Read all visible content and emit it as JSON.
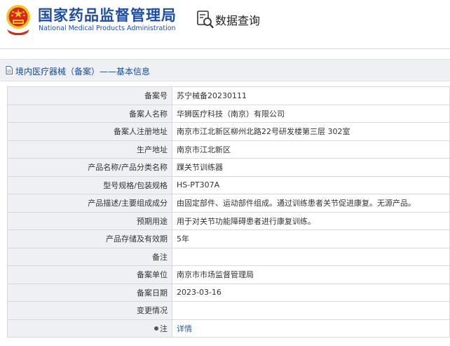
{
  "header": {
    "agency_name_cn": "国家药品监督管理局",
    "agency_name_en": "National Medical Products Administration",
    "page_title": "数据查询"
  },
  "breadcrumb": {
    "text": "境内医疗器械（备案）——基本信息"
  },
  "records": [
    {
      "label": "备案号",
      "value": "苏宁械备20230111"
    },
    {
      "label": "备案人名称",
      "value": "华狮医疗科技（南京）有限公司"
    },
    {
      "label": "备案人注册地址",
      "value": "南京市江北新区柳州北路22号研发楼第三层 302室"
    },
    {
      "label": "生产地址",
      "value": "南京市江北新区"
    },
    {
      "label": "产品名称/产品分类名称",
      "value": "踝关节训练器"
    },
    {
      "label": "型号规格/包装规格",
      "value": "HS-PT307A"
    },
    {
      "label": "产品描述/主要组成成分",
      "value": "由固定部件、运动部件组成。通过训练患者关节促进康复。无源产品。"
    },
    {
      "label": "预期用途",
      "value": "用于对关节功能障碍患者进行康复训练。"
    },
    {
      "label": "产品存储及有效期",
      "value": "5年"
    },
    {
      "label": "备注",
      "value": ""
    },
    {
      "label": "备案单位",
      "value": "南京市市场监督管理局"
    },
    {
      "label": "备案日期",
      "value": "2023-03-16"
    },
    {
      "label": "变更情况",
      "value": ""
    }
  ],
  "note_row": {
    "label": "注",
    "link_text": "详情",
    "icon": "dot-icon"
  },
  "colors": {
    "brand_blue": "#1f4ea8",
    "emblem_red": "#d8261c",
    "emblem_gold": "#f3c623",
    "label_bg": "#eef0f3",
    "link_blue": "#1e5bb8"
  }
}
